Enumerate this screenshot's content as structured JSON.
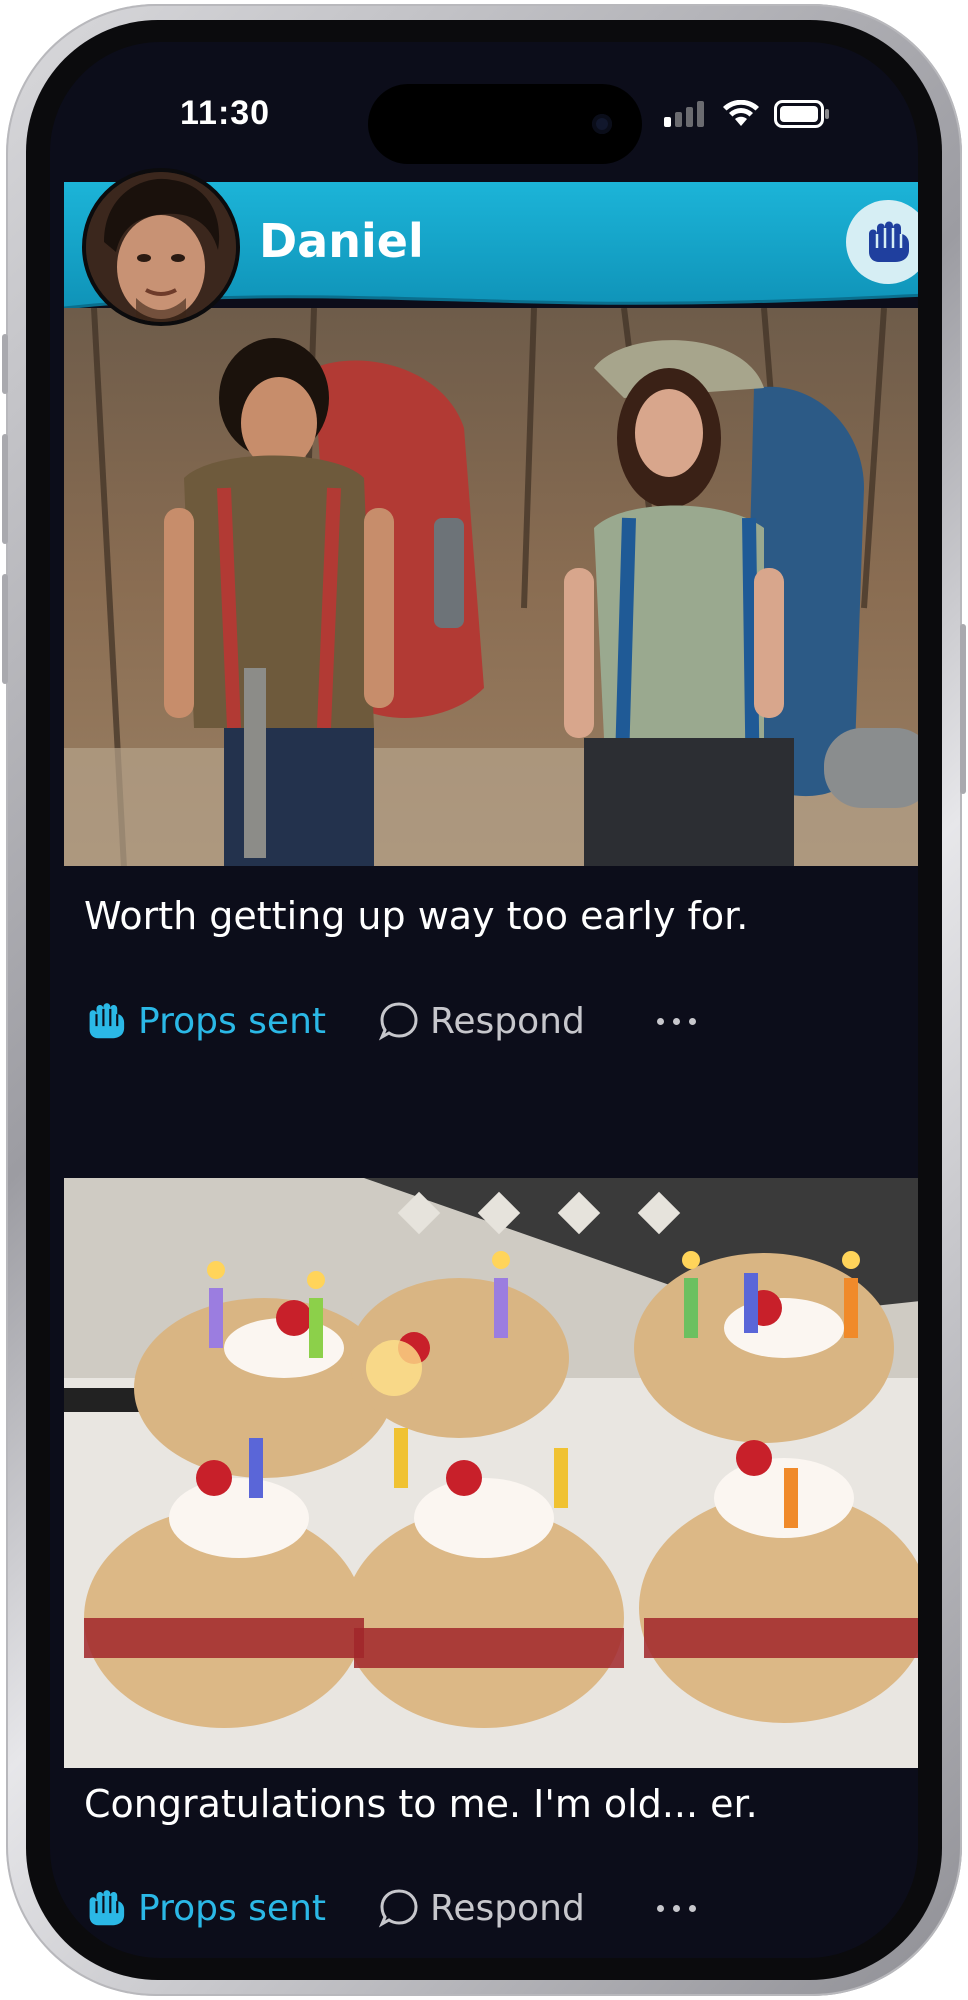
{
  "status_bar": {
    "time": "11:30",
    "icons": [
      "signal-icon",
      "wifi-icon",
      "battery-icon"
    ]
  },
  "profile": {
    "name": "Daniel",
    "header_color": "#1eb6d6",
    "props_button_icon": "fist-bump-icon"
  },
  "posts": [
    {
      "image": "Two hikers with large backpacks smiling in a forest",
      "caption": "Worth getting up way too early for.",
      "props_label": "Props sent",
      "respond_label": "Respond",
      "more_icon": "ellipsis-icon"
    },
    {
      "image": "Strawberry shortcakes with lit letter candles spelling HAPPY BIRTHDAY",
      "caption": "Congratulations to me. I'm old... er.",
      "props_label": "Props sent",
      "respond_label": "Respond",
      "more_icon": "ellipsis-icon"
    }
  ],
  "colors": {
    "background": "#0c0d1a",
    "accent": "#2bb8e6",
    "muted": "#c7c7cc"
  }
}
